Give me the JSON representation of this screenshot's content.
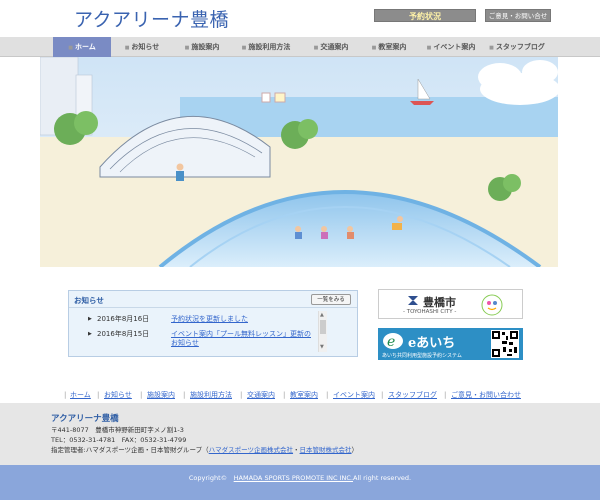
{
  "header": {
    "site_title": "アクアリーナ豊橋",
    "reserve_label": "予約状況",
    "contact_label": "ご意見・お問い合せ"
  },
  "nav": {
    "items": [
      {
        "label": "ホーム"
      },
      {
        "label": "お知らせ"
      },
      {
        "label": "施設案内"
      },
      {
        "label": "施設利用方法"
      },
      {
        "label": "交通案内"
      },
      {
        "label": "教室案内"
      },
      {
        "label": "イベント案内"
      },
      {
        "label": "スタッフブログ"
      }
    ]
  },
  "news": {
    "title": "お知らせ",
    "more_label": "一覧をみる",
    "items": [
      {
        "date": "2016年8月16日",
        "text": "予約状況を更新しました"
      },
      {
        "date": "2016年8月15日",
        "text": "イベント案内「プール無料レッスン」更新のお知らせ"
      }
    ]
  },
  "banners": {
    "city_name": "豊橋市",
    "city_sub": "- TOYOHASHI CITY -",
    "aichi_logo": "eあいち",
    "aichi_sub": "あいち共同利用型施設予約システム"
  },
  "footer_nav": {
    "items": [
      {
        "label": "ホーム"
      },
      {
        "label": "お知らせ"
      },
      {
        "label": "施設案内"
      },
      {
        "label": "施設利用方法"
      },
      {
        "label": "交通案内"
      },
      {
        "label": "教室案内"
      },
      {
        "label": "イベント案内"
      },
      {
        "label": "スタッフブログ"
      },
      {
        "label": "ご意見・お問い合わせ"
      }
    ]
  },
  "footer": {
    "title": "アクアリーナ豊橋",
    "address": "〒441-8077　豊橋市神野新田町字メノ割1-3",
    "tel": "TEL：0532-31-4781　FAX：0532-31-4799",
    "manager_prefix": "指定管理者:ハマダスポーツ企画・日本管財グループ（",
    "manager_link1": "ハマダスポーツ企画株式会社",
    "manager_mid": "・",
    "manager_link2": "日本管財株式会社",
    "manager_suffix": "）"
  },
  "copyright": {
    "prefix": "Copyright©　",
    "link": "HAMADA SPORTS PROMOTE INC INC.",
    "suffix": "All right reserved."
  },
  "colors": {
    "accent": "#3a63b0",
    "nav_active": "#7a8bc4",
    "copyright_bg": "#8aa6db"
  }
}
